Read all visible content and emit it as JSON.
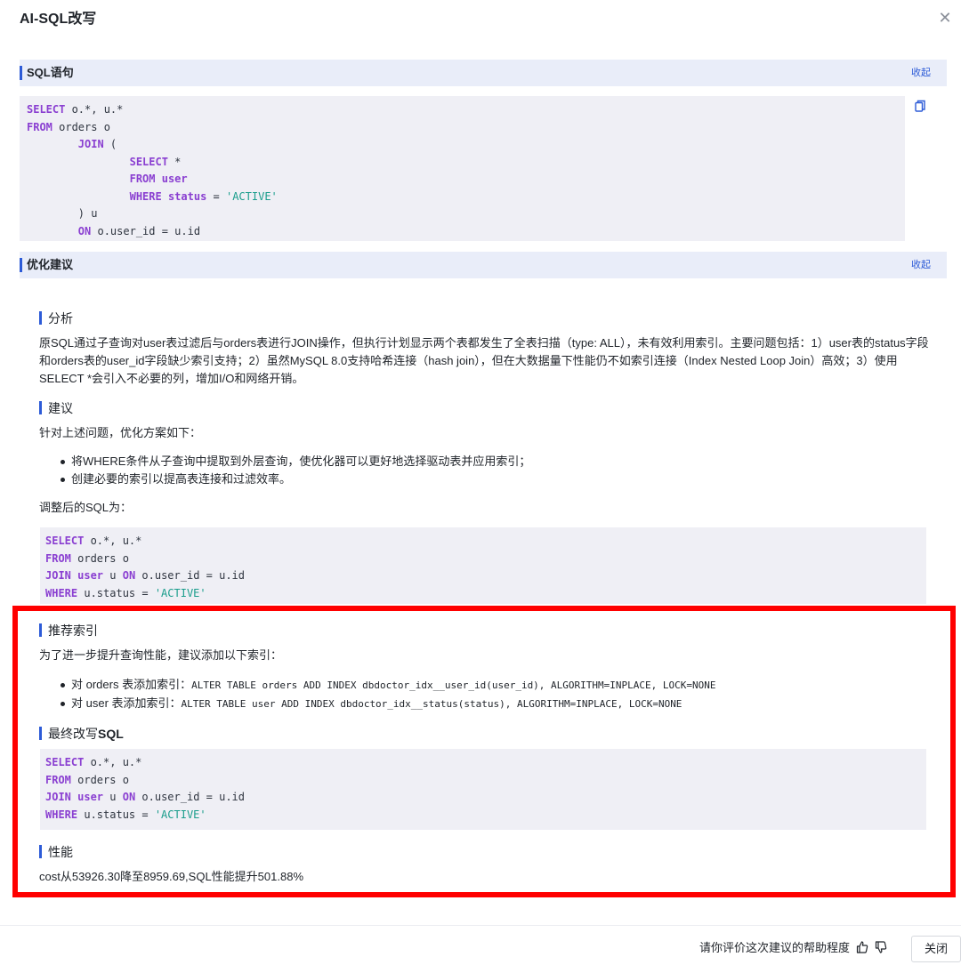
{
  "dialog": {
    "title": "AI-SQL改写",
    "close_icon": "close-icon"
  },
  "sql_section": {
    "title": "SQL语句",
    "collapse_label": "收起",
    "copy_icon": "copy-icon",
    "code": [
      [
        [
          "kw",
          "SELECT"
        ],
        [
          "t",
          " o.*, u.*"
        ]
      ],
      [
        [
          "kw",
          "FROM"
        ],
        [
          "t",
          " orders o"
        ]
      ],
      [
        [
          "t",
          "        "
        ],
        [
          "kw",
          "JOIN"
        ],
        [
          "t",
          " ("
        ]
      ],
      [
        [
          "t",
          "                "
        ],
        [
          "kw",
          "SELECT"
        ],
        [
          "t",
          " *"
        ]
      ],
      [
        [
          "t",
          "                "
        ],
        [
          "kw",
          "FROM user"
        ]
      ],
      [
        [
          "t",
          "                "
        ],
        [
          "kw",
          "WHERE status"
        ],
        [
          "t",
          " = "
        ],
        [
          "st",
          "'ACTIVE'"
        ]
      ],
      [
        [
          "t",
          "        ) u"
        ]
      ],
      [
        [
          "t",
          "        "
        ],
        [
          "kw",
          "ON"
        ],
        [
          "t",
          " o.user_id = u.id"
        ]
      ]
    ]
  },
  "optimize_section": {
    "title": "优化建议",
    "collapse_label": "收起",
    "analysis": {
      "title": "分析",
      "text": "原SQL通过子查询对user表过滤后与orders表进行JOIN操作，但执行计划显示两个表都发生了全表扫描（type: ALL），未有效利用索引。主要问题包括：1）user表的status字段和orders表的user_id字段缺少索引支持；2）虽然MySQL 8.0支持哈希连接（hash join），但在大数据量下性能仍不如索引连接（Index Nested Loop Join）高效；3）使用 SELECT *会引入不必要的列，增加I/O和网络开销。"
    },
    "suggestion": {
      "title": "建议",
      "intro": "针对上述问题，优化方案如下：",
      "bullets": [
        "将WHERE条件从子查询中提取到外层查询，使优化器可以更好地选择驱动表并应用索引；",
        "创建必要的索引以提高表连接和过滤效率。"
      ],
      "adjusted_label": "调整后的SQL为：",
      "code": [
        [
          [
            "kw",
            "SELECT"
          ],
          [
            "t",
            " o.*, u.*"
          ]
        ],
        [
          [
            "kw",
            "FROM"
          ],
          [
            "t",
            " orders o"
          ]
        ],
        [
          [
            "kw",
            "JOIN user"
          ],
          [
            "t",
            " u "
          ],
          [
            "kw",
            "ON"
          ],
          [
            "t",
            " o.user_id = u.id"
          ]
        ],
        [
          [
            "kw",
            "WHERE"
          ],
          [
            "t",
            " u.status = "
          ],
          [
            "st",
            "'ACTIVE'"
          ]
        ]
      ]
    },
    "index": {
      "title": "推荐索引",
      "intro": "为了进一步提升查询性能，建议添加以下索引：",
      "items": [
        {
          "prefix": "对 orders 表添加索引：",
          "sql": "ALTER TABLE orders ADD INDEX dbdoctor_idx__user_id(user_id), ALGORITHM=INPLACE, LOCK=NONE"
        },
        {
          "prefix": "对 user 表添加索引：",
          "sql": "ALTER TABLE user ADD INDEX dbdoctor_idx__status(status), ALGORITHM=INPLACE, LOCK=NONE"
        }
      ]
    },
    "final_sql": {
      "title_prefix": "最终改写",
      "title_suffix": "SQL",
      "code": [
        [
          [
            "kw",
            "SELECT"
          ],
          [
            "t",
            " o.*, u.*"
          ]
        ],
        [
          [
            "kw",
            "FROM"
          ],
          [
            "t",
            " orders o"
          ]
        ],
        [
          [
            "kw",
            "JOIN user"
          ],
          [
            "t",
            " u "
          ],
          [
            "kw",
            "ON"
          ],
          [
            "t",
            " o.user_id = u.id"
          ]
        ],
        [
          [
            "kw",
            "WHERE"
          ],
          [
            "t",
            " u.status = "
          ],
          [
            "st",
            "'ACTIVE'"
          ]
        ]
      ]
    },
    "performance": {
      "title": "性能",
      "text": "cost从53926.30降至8959.69,SQL性能提升501.88%"
    }
  },
  "footer": {
    "rating_text": "请你评价这次建议的帮助程度",
    "thumbs_up_icon": "thumbs-up-icon",
    "thumbs_down_icon": "thumbs-down-icon",
    "close_label": "关闭"
  },
  "colors": {
    "accent": "#2d5bd7",
    "highlight_border": "#ff0000",
    "keyword": "#8a3fd1",
    "string": "#1a9d8c"
  }
}
